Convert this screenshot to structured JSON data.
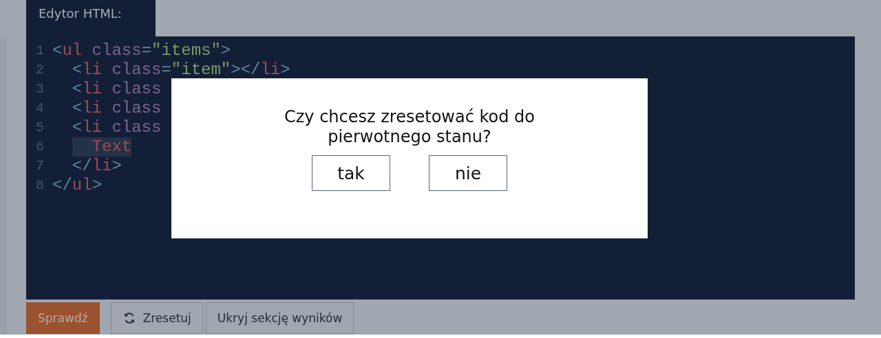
{
  "editor": {
    "tab": "Edytor HTML:",
    "lines": [
      {
        "number": "1",
        "indented": false,
        "tokens": [
          {
            "kind": "punct",
            "text": "<"
          },
          {
            "kind": "tag",
            "text": "ul"
          },
          {
            "kind": "space"
          },
          {
            "kind": "attr",
            "text": "class"
          },
          {
            "kind": "punct",
            "text": "="
          },
          {
            "kind": "string",
            "text": "\"items\""
          },
          {
            "kind": "punct",
            "text": ">"
          }
        ]
      },
      {
        "number": "2",
        "indented": true,
        "tokens": [
          {
            "kind": "punct",
            "text": "<"
          },
          {
            "kind": "tag",
            "text": "li"
          },
          {
            "kind": "space"
          },
          {
            "kind": "attr",
            "text": "class"
          },
          {
            "kind": "punct",
            "text": "="
          },
          {
            "kind": "string",
            "text": "\"item\""
          },
          {
            "kind": "punct",
            "text": "></"
          },
          {
            "kind": "tag",
            "text": "li"
          },
          {
            "kind": "punct",
            "text": ">"
          }
        ]
      },
      {
        "number": "3",
        "indented": true,
        "tokens": [
          {
            "kind": "punct",
            "text": "<"
          },
          {
            "kind": "tag",
            "text": "li"
          },
          {
            "kind": "space"
          },
          {
            "kind": "attr",
            "text": "class"
          }
        ]
      },
      {
        "number": "4",
        "indented": true,
        "tokens": [
          {
            "kind": "punct",
            "text": "<"
          },
          {
            "kind": "tag",
            "text": "li"
          },
          {
            "kind": "space"
          },
          {
            "kind": "attr",
            "text": "class"
          }
        ]
      },
      {
        "number": "5",
        "indented": true,
        "tokens": [
          {
            "kind": "punct",
            "text": "<"
          },
          {
            "kind": "tag",
            "text": "li"
          },
          {
            "kind": "space"
          },
          {
            "kind": "attr",
            "text": "class"
          }
        ]
      },
      {
        "number": "6",
        "indented": true,
        "tokens": [
          {
            "kind": "selected",
            "text": "Text"
          }
        ]
      },
      {
        "number": "7",
        "indented": true,
        "tokens": [
          {
            "kind": "punct",
            "text": "</"
          },
          {
            "kind": "tag",
            "text": "li"
          },
          {
            "kind": "punct",
            "text": ">"
          }
        ]
      },
      {
        "number": "8",
        "indented": false,
        "tokens": [
          {
            "kind": "punct",
            "text": "</"
          },
          {
            "kind": "tag",
            "text": "ul"
          },
          {
            "kind": "punct",
            "text": ">"
          }
        ]
      }
    ]
  },
  "actions": [
    {
      "kind": "primary",
      "label": "Sprawdź"
    },
    {
      "kind": "reset",
      "label": "Zresetuj"
    },
    {
      "kind": "plain",
      "label": "Ukryj sekcję wyników"
    }
  ],
  "dialog": {
    "message": "Czy chcesz zresetować kod do pierwotnego stanu?",
    "buttons": [
      "tak",
      "nie"
    ]
  }
}
